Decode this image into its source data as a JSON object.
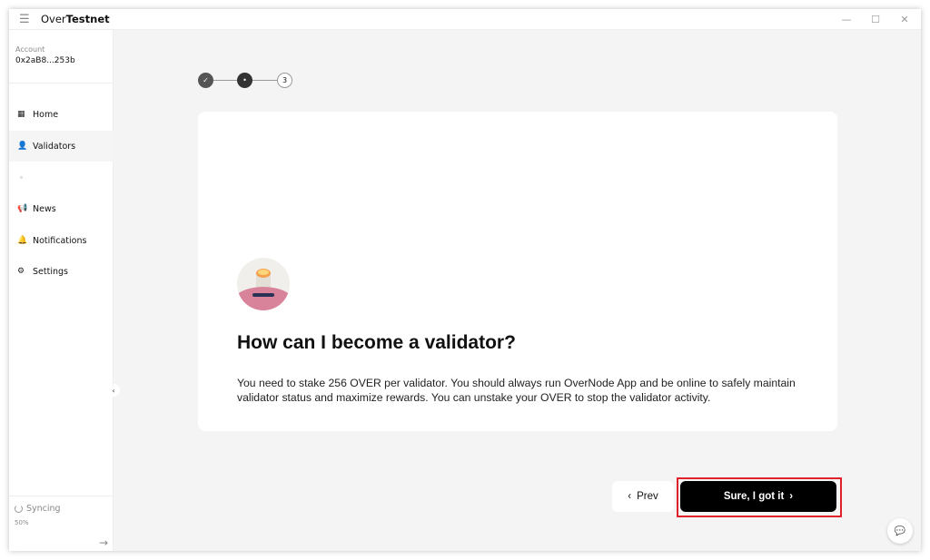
{
  "app": {
    "title_prefix": "Over",
    "title_bold": "Testnet"
  },
  "window_controls": {
    "minimize": "—",
    "maximize": "☐",
    "close": "✕"
  },
  "sidebar": {
    "account_label": "Account",
    "account_value": "0x2aB8...253b",
    "items": [
      {
        "label": "Home",
        "icon": "grid-icon"
      },
      {
        "label": "Validators",
        "icon": "users-icon",
        "active": true
      },
      {
        "label": "News",
        "icon": "megaphone-icon"
      },
      {
        "label": "Notifications",
        "icon": "bell-icon"
      },
      {
        "label": "Settings",
        "icon": "gear-icon"
      }
    ],
    "sync_label": "Syncing",
    "sync_percent": "50%",
    "sync_progress": 50
  },
  "stepper": {
    "steps": [
      {
        "state": "done"
      },
      {
        "state": "current"
      },
      {
        "state": "pending",
        "label": "3"
      }
    ]
  },
  "card": {
    "title": "How can I become a validator?",
    "description": "You need to stake 256 OVER per validator. You should always run OverNode App and be online to safely maintain validator status and maximize rewards. You can unstake your OVER to stop the validator activity."
  },
  "buttons": {
    "prev": "Prev",
    "next": "Sure, I got it"
  },
  "colors": {
    "highlight": "#e0202a",
    "primary": "#000000"
  }
}
